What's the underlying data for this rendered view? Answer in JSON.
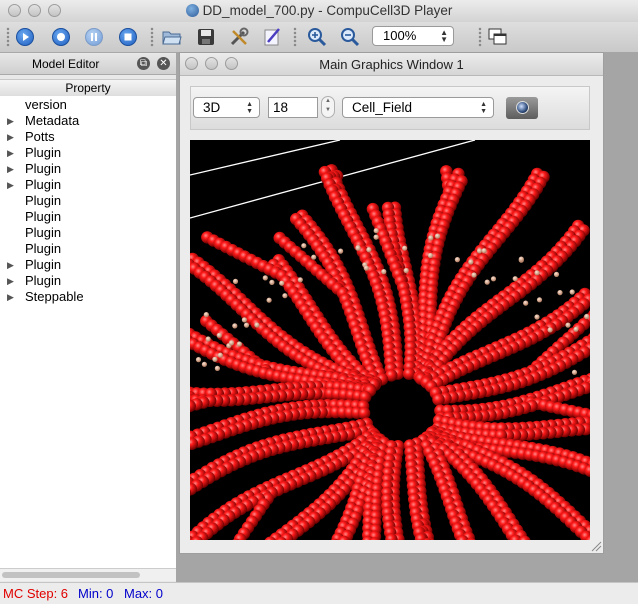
{
  "window": {
    "title": "DD_model_700.py - CompuCell3D Player"
  },
  "toolbar": {
    "buttons": [
      "run-icon",
      "step-icon",
      "pause-icon",
      "stop-icon",
      "open-folder-icon",
      "save-icon",
      "tools-icon",
      "edit-icon",
      "zoom-in-icon",
      "zoom-out-icon",
      "window-layout-icon"
    ],
    "zoom_value": "100%"
  },
  "model_editor": {
    "title": "Model Editor",
    "column_header": "Property",
    "items": [
      {
        "label": "version",
        "expandable": false
      },
      {
        "label": "Metadata",
        "expandable": true
      },
      {
        "label": "Potts",
        "expandable": true
      },
      {
        "label": "Plugin",
        "expandable": true
      },
      {
        "label": "Plugin",
        "expandable": true
      },
      {
        "label": "Plugin",
        "expandable": true
      },
      {
        "label": "Plugin",
        "expandable": false
      },
      {
        "label": "Plugin",
        "expandable": false
      },
      {
        "label": "Plugin",
        "expandable": false
      },
      {
        "label": "Plugin",
        "expandable": false
      },
      {
        "label": "Plugin",
        "expandable": true
      },
      {
        "label": "Plugin",
        "expandable": true
      },
      {
        "label": "Steppable",
        "expandable": true
      }
    ]
  },
  "graphics_window": {
    "title": "Main Graphics Window 1",
    "view_mode": "3D",
    "plane_value": "18",
    "field": "Cell_Field",
    "cell_color": "#ff1a1a",
    "background_color": "#000000",
    "particle_color": "#e8b89a"
  },
  "status": {
    "mc_step": "MC Step: 6",
    "min": "Min: 0",
    "max": "Max: 0",
    "mc_color": "#e00000",
    "minmax_color": "#0000cc"
  }
}
